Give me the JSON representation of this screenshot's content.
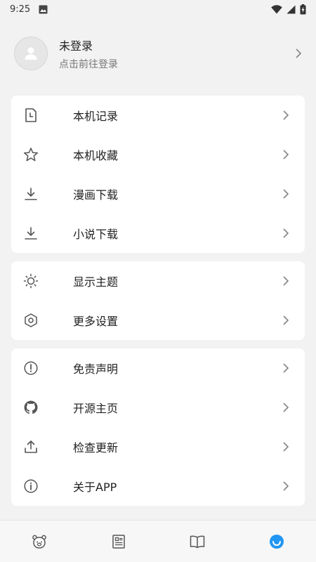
{
  "status_bar": {
    "time": "9:25"
  },
  "user": {
    "name": "未登录",
    "subtitle": "点击前往登录"
  },
  "groups": [
    {
      "items": [
        {
          "label": "本机记录",
          "icon": "history-file-icon"
        },
        {
          "label": "本机收藏",
          "icon": "star-icon"
        },
        {
          "label": "漫画下载",
          "icon": "download-icon"
        },
        {
          "label": "小说下载",
          "icon": "download-icon"
        }
      ]
    },
    {
      "items": [
        {
          "label": "显示主题",
          "icon": "sun-icon"
        },
        {
          "label": "更多设置",
          "icon": "hexagon-settings-icon"
        }
      ]
    },
    {
      "items": [
        {
          "label": "免责声明",
          "icon": "alert-circle-icon"
        },
        {
          "label": "开源主页",
          "icon": "github-icon"
        },
        {
          "label": "检查更新",
          "icon": "upload-icon"
        },
        {
          "label": "关于APP",
          "icon": "info-circle-icon"
        }
      ]
    }
  ],
  "bottom_nav": {
    "items": [
      "bear-icon",
      "list-icon",
      "book-open-icon",
      "smile-icon"
    ],
    "active_index": 3
  },
  "colors": {
    "accent": "#2196f3",
    "icon": "#555555",
    "chevron": "#8a8a8a",
    "background": "#f2f2f2"
  }
}
